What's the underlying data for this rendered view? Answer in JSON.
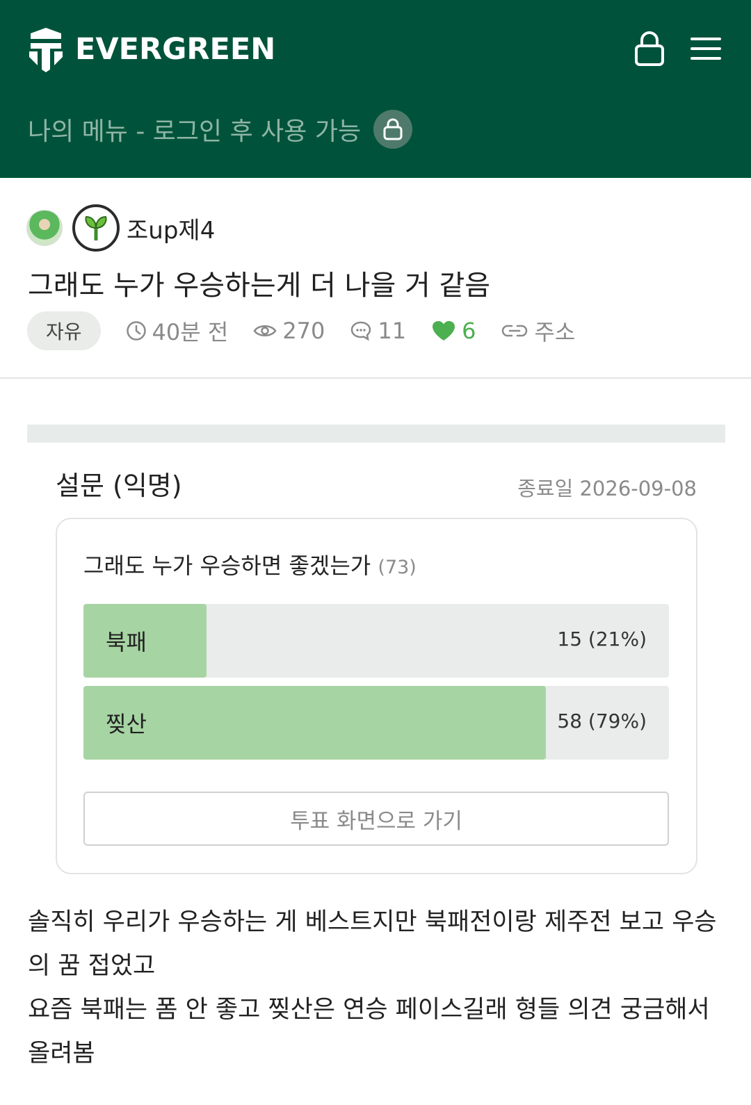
{
  "header": {
    "brand": "EVERGREEN",
    "my_menu": "나의 메뉴 - 로그인 후 사용 가능",
    "icons": [
      "logo-icon",
      "lock-icon",
      "hamburger-menu-icon"
    ]
  },
  "post": {
    "author": "조up제4",
    "title": "그래도 누가 우승하는게 더 나을 거 같음",
    "category": "자유",
    "time": "40분 전",
    "views": "270",
    "comments": "11",
    "likes": "6",
    "link_label": "주소"
  },
  "survey": {
    "heading": "설문 (익명)",
    "end_date": "종료일 2026-09-08",
    "question": "그래도 누가 우승하면 좋겠는가",
    "total": "(73)",
    "options": [
      {
        "label": "북패",
        "value": "15 (21%)",
        "ratio": 0.21
      },
      {
        "label": "찢산",
        "value": "58 (79%)",
        "ratio": 0.79
      }
    ],
    "vote_button": "투표 화면으로 가기"
  },
  "content": {
    "paragraphs": [
      "솔직히 우리가 우승하는 게 베스트지만 북패전이랑 제주전 보고 우승의 꿈 접었고",
      "요즘 북패는 폼 안 좋고 찢산은 연승 페이스길래 형들 의견 궁금해서 올려봄"
    ]
  },
  "colors": {
    "header_bg": "#00533a",
    "poll_fill": "#a7d4a3",
    "like_green": "#4caf50"
  }
}
